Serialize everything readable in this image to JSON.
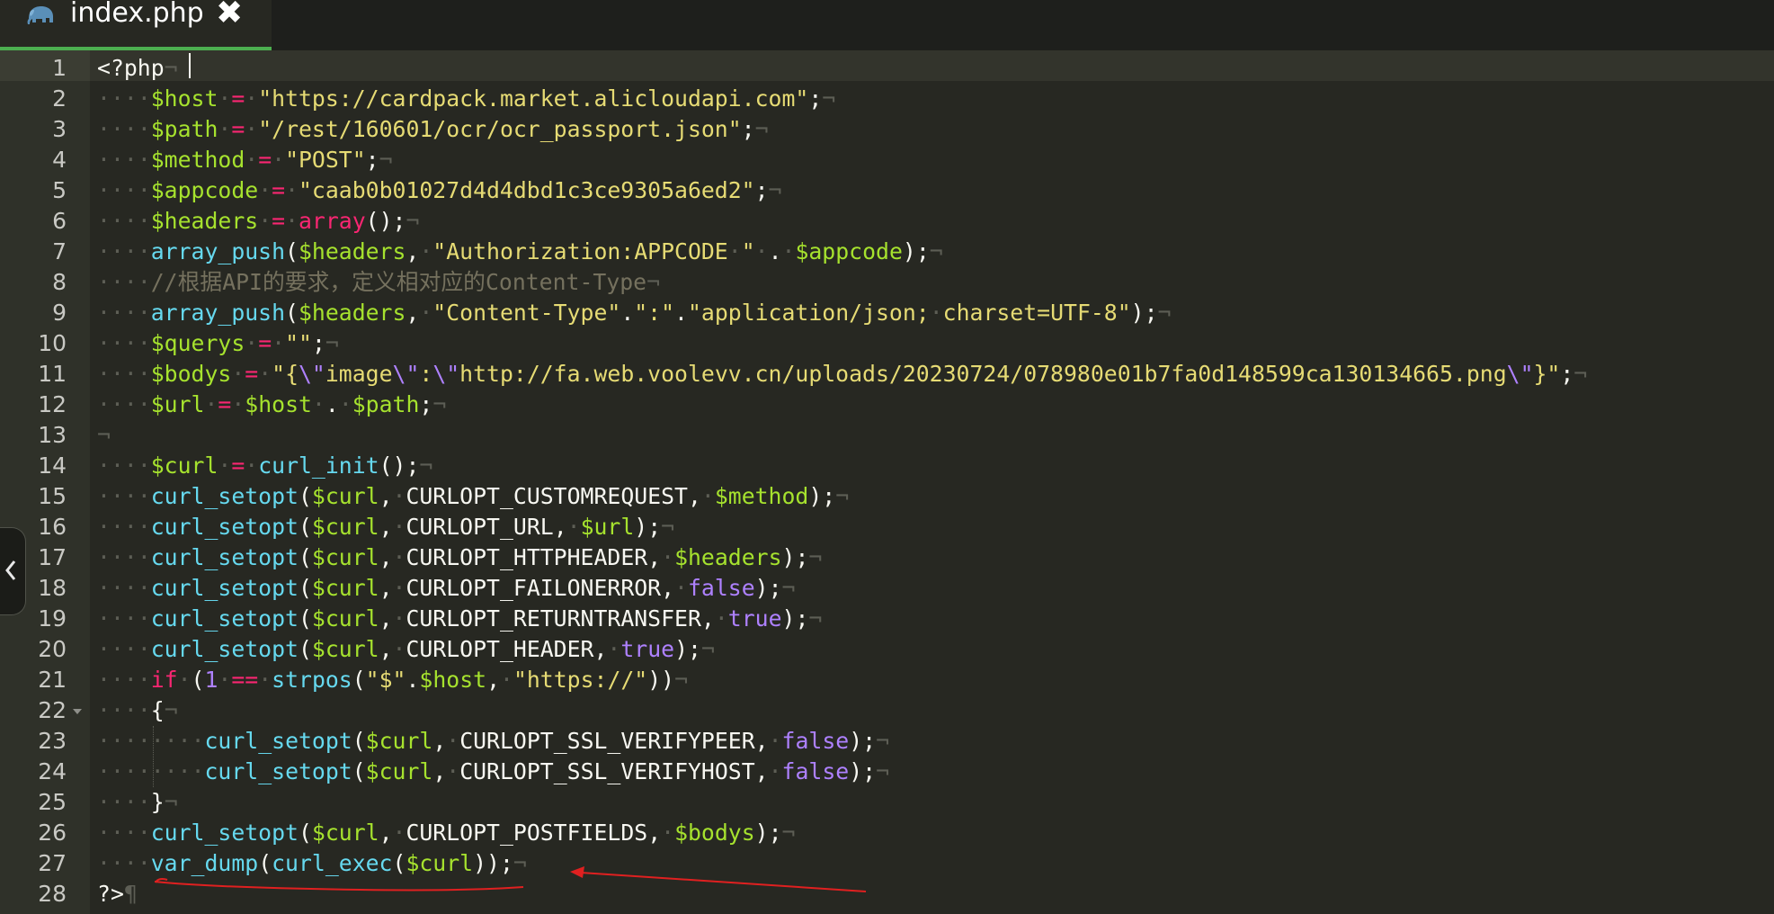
{
  "tab": {
    "title": "index.php",
    "close_glyph": "✖",
    "icon": "elephant-icon"
  },
  "editor": {
    "accent_color": "#4caf50",
    "line_numbers": [
      "1",
      "2",
      "3",
      "4",
      "5",
      "6",
      "7",
      "8",
      "9",
      "10",
      "11",
      "12",
      "13",
      "14",
      "15",
      "16",
      "17",
      "18",
      "19",
      "20",
      "21",
      "22",
      "23",
      "24",
      "25",
      "26",
      "27",
      "28"
    ],
    "lines": [
      {
        "number": "1",
        "text": "<?php¬"
      },
      {
        "number": "2",
        "text": "····$host·=·\"https://cardpack.market.alicloudapi.com\";¬"
      },
      {
        "number": "3",
        "text": "····$path·=·\"/rest/160601/ocr/ocr_passport.json\";¬"
      },
      {
        "number": "4",
        "text": "····$method·=·\"POST\";¬"
      },
      {
        "number": "5",
        "text": "····$appcode·=·\"caab0b01027d4d4dbd1c3ce9305a6ed2\";¬"
      },
      {
        "number": "6",
        "text": "····$headers·=·array();¬"
      },
      {
        "number": "7",
        "text": "····array_push($headers,·\"Authorization:APPCODE·\"·.·$appcode);¬"
      },
      {
        "number": "8",
        "text": "····//根据API的要求，定义相对应的Content-Type¬"
      },
      {
        "number": "9",
        "text": "····array_push($headers,·\"Content-Type\".\":\".\"application/json;·charset=UTF-8\");¬"
      },
      {
        "number": "10",
        "text": "····$querys·=·\"\";¬"
      },
      {
        "number": "11",
        "text": "····$bodys·=·\"{\\\"image\\\":\\\"http://fa.web.voolevv.cn/uploads/20230724/078980e01b7fa0d148599ca130134665.png\\\"}\";¬"
      },
      {
        "number": "12",
        "text": "····$url·=·$host·.·$path;¬"
      },
      {
        "number": "13",
        "text": "¬"
      },
      {
        "number": "14",
        "text": "····$curl·=·curl_init();¬"
      },
      {
        "number": "15",
        "text": "····curl_setopt($curl,·CURLOPT_CUSTOMREQUEST,·$method);¬"
      },
      {
        "number": "16",
        "text": "····curl_setopt($curl,·CURLOPT_URL,·$url);¬"
      },
      {
        "number": "17",
        "text": "····curl_setopt($curl,·CURLOPT_HTTPHEADER,·$headers);¬"
      },
      {
        "number": "18",
        "text": "····curl_setopt($curl,·CURLOPT_FAILONERROR,·false);¬"
      },
      {
        "number": "19",
        "text": "····curl_setopt($curl,·CURLOPT_RETURNTRANSFER,·true);¬"
      },
      {
        "number": "20",
        "text": "····curl_setopt($curl,·CURLOPT_HEADER,·true);¬"
      },
      {
        "number": "21",
        "text": "····if·(1·==·strpos(\"$\".$host,·\"https://\"))¬"
      },
      {
        "number": "22",
        "text": "····{¬"
      },
      {
        "number": "23",
        "text": "········curl_setopt($curl,·CURLOPT_SSL_VERIFYPEER,·false);¬"
      },
      {
        "number": "24",
        "text": "········curl_setopt($curl,·CURLOPT_SSL_VERIFYHOST,·false);¬"
      },
      {
        "number": "25",
        "text": "····}¬"
      },
      {
        "number": "26",
        "text": "····curl_setopt($curl,·CURLOPT_POSTFIELDS,·$bodys);¬"
      },
      {
        "number": "27",
        "text": "····var_dump(curl_exec($curl));¬"
      },
      {
        "number": "28",
        "text": "?>¶"
      }
    ],
    "fold_marker_line": "22",
    "current_line": "1"
  },
  "theme": {
    "background": "#272822",
    "keyword": "#f92672",
    "variable": "#a6e22e",
    "string": "#e6db74",
    "function": "#66d9ef",
    "constant": "#ae81ff",
    "comment": "#75715e",
    "whitespace_marker": "#5d5e55",
    "annotation": "#e02020"
  },
  "annotations": {
    "underline_line": "27",
    "arrow_points_to_line": "27"
  }
}
